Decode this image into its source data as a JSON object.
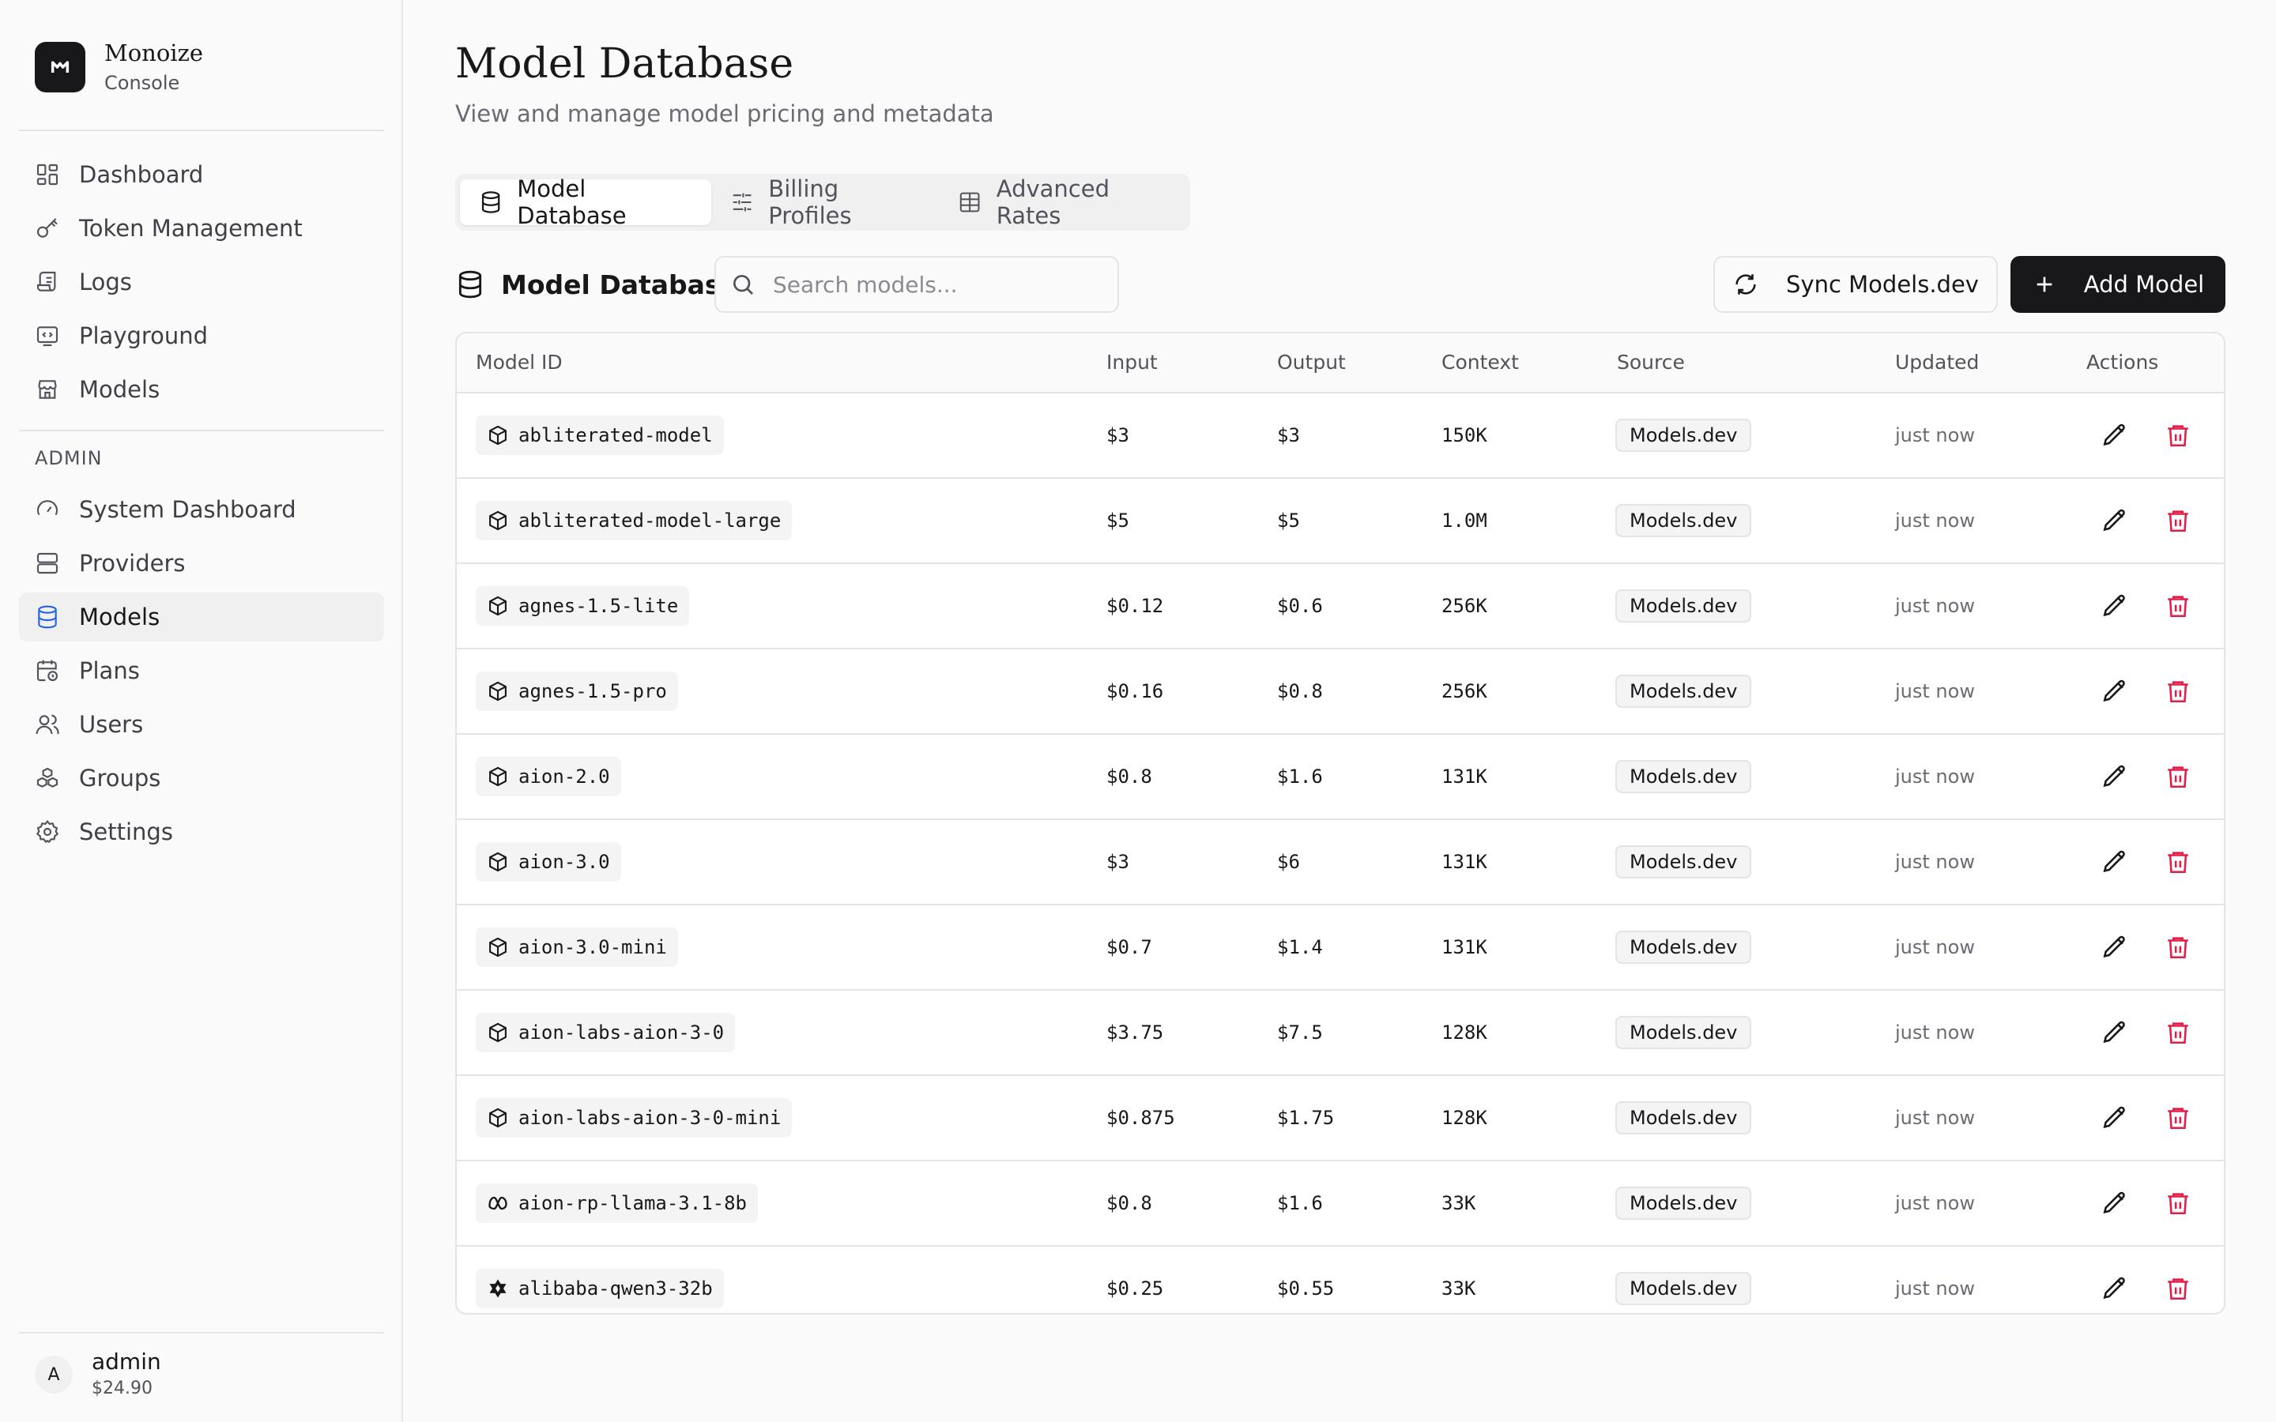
{
  "brand": {
    "name": "Monoize",
    "subtitle": "Console",
    "logo_letter": "M"
  },
  "sidebar": {
    "items": [
      {
        "label": "Dashboard",
        "icon": "dashboard-icon"
      },
      {
        "label": "Token Management",
        "icon": "key-icon"
      },
      {
        "label": "Logs",
        "icon": "logs-icon"
      },
      {
        "label": "Playground",
        "icon": "code-icon"
      },
      {
        "label": "Models",
        "icon": "store-icon"
      }
    ],
    "admin_label": "ADMIN",
    "admin_items": [
      {
        "label": "System Dashboard",
        "icon": "gauge-icon"
      },
      {
        "label": "Providers",
        "icon": "server-icon"
      },
      {
        "label": "Models",
        "icon": "database-icon",
        "active": true
      },
      {
        "label": "Plans",
        "icon": "calendar-clock-icon"
      },
      {
        "label": "Users",
        "icon": "users-icon"
      },
      {
        "label": "Groups",
        "icon": "boxes-icon"
      },
      {
        "label": "Settings",
        "icon": "gear-icon"
      }
    ]
  },
  "user": {
    "initial": "A",
    "name": "admin",
    "balance": "$24.90"
  },
  "page": {
    "title": "Model Database",
    "subtitle": "View and manage model pricing and metadata"
  },
  "tabs": [
    {
      "label": "Model Database",
      "icon": "database-icon",
      "active": true
    },
    {
      "label": "Billing Profiles",
      "icon": "sliders-icon"
    },
    {
      "label": "Advanced Rates",
      "icon": "table-icon"
    }
  ],
  "toolbar": {
    "title": "Model Database",
    "search_placeholder": "Search models...",
    "sync_label": "Sync Models.dev",
    "add_label": "Add Model"
  },
  "table": {
    "columns": [
      "Model ID",
      "Input",
      "Output",
      "Context",
      "Source",
      "Updated",
      "Actions"
    ],
    "rows": [
      {
        "id": "abliterated-model",
        "icon": "cube-icon",
        "input": "$3",
        "output": "$3",
        "context": "150K",
        "source": "Models.dev",
        "updated": "just now"
      },
      {
        "id": "abliterated-model-large",
        "icon": "cube-icon",
        "input": "$5",
        "output": "$5",
        "context": "1.0M",
        "source": "Models.dev",
        "updated": "just now"
      },
      {
        "id": "agnes-1.5-lite",
        "icon": "cube-icon",
        "input": "$0.12",
        "output": "$0.6",
        "context": "256K",
        "source": "Models.dev",
        "updated": "just now"
      },
      {
        "id": "agnes-1.5-pro",
        "icon": "cube-icon",
        "input": "$0.16",
        "output": "$0.8",
        "context": "256K",
        "source": "Models.dev",
        "updated": "just now"
      },
      {
        "id": "aion-2.0",
        "icon": "cube-icon",
        "input": "$0.8",
        "output": "$1.6",
        "context": "131K",
        "source": "Models.dev",
        "updated": "just now"
      },
      {
        "id": "aion-3.0",
        "icon": "cube-icon",
        "input": "$3",
        "output": "$6",
        "context": "131K",
        "source": "Models.dev",
        "updated": "just now"
      },
      {
        "id": "aion-3.0-mini",
        "icon": "cube-icon",
        "input": "$0.7",
        "output": "$1.4",
        "context": "131K",
        "source": "Models.dev",
        "updated": "just now"
      },
      {
        "id": "aion-labs-aion-3-0",
        "icon": "cube-icon",
        "input": "$3.75",
        "output": "$7.5",
        "context": "128K",
        "source": "Models.dev",
        "updated": "just now"
      },
      {
        "id": "aion-labs-aion-3-0-mini",
        "icon": "cube-icon",
        "input": "$0.875",
        "output": "$1.75",
        "context": "128K",
        "source": "Models.dev",
        "updated": "just now"
      },
      {
        "id": "aion-rp-llama-3.1-8b",
        "icon": "meta-icon",
        "input": "$0.8",
        "output": "$1.6",
        "context": "33K",
        "source": "Models.dev",
        "updated": "just now"
      },
      {
        "id": "alibaba-qwen3-32b",
        "icon": "qwen-icon",
        "input": "$0.25",
        "output": "$0.55",
        "context": "33K",
        "source": "Models.dev",
        "updated": "just now"
      }
    ]
  },
  "colors": {
    "accent": "#2563eb",
    "danger": "#e11d48",
    "primary": "#18181b"
  }
}
